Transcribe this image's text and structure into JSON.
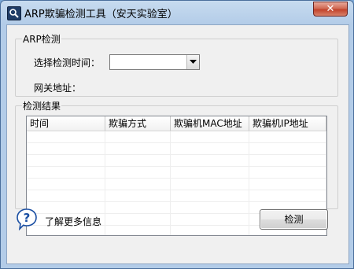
{
  "window": {
    "title": "ARP欺骗检测工具（安天实验室）",
    "close_glyph": "✕"
  },
  "arp_group": {
    "legend": "ARP检测",
    "time_label": "选择检测时间：",
    "time_value": "",
    "gateway_label": "网关地址："
  },
  "results_group": {
    "legend": "检测结果",
    "columns": [
      "时间",
      "欺骗方式",
      "欺骗机MAC地址",
      "欺骗机IP地址"
    ]
  },
  "footer": {
    "help_text": "了解更多信息",
    "detect_button": "检测"
  },
  "colors": {
    "titlebar": "#b3cce8",
    "close_button": "#c2432b",
    "help_icon": "#1b4fa3"
  }
}
